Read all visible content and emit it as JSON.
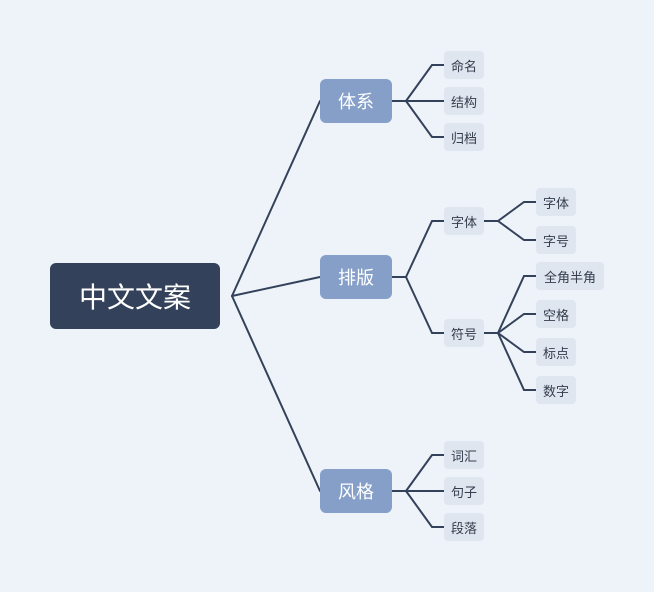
{
  "root": {
    "label": "中文文案"
  },
  "branches": [
    {
      "label": "体系",
      "children": [
        "命名",
        "结构",
        "归档"
      ]
    },
    {
      "label": "排版",
      "children": [
        {
          "label": "字体",
          "children": [
            "字体",
            "字号"
          ]
        },
        {
          "label": "符号",
          "children": [
            "全角半角",
            "空格",
            "标点",
            "数字"
          ]
        }
      ]
    },
    {
      "label": "风格",
      "children": [
        "词汇",
        "句子",
        "段落"
      ]
    }
  ],
  "colors": {
    "background": "#EDF3F9",
    "root_fill": "#33425A",
    "branch_fill": "#859FC8",
    "leaf_fill": "#DFE6EF",
    "connector": "#33425A"
  }
}
